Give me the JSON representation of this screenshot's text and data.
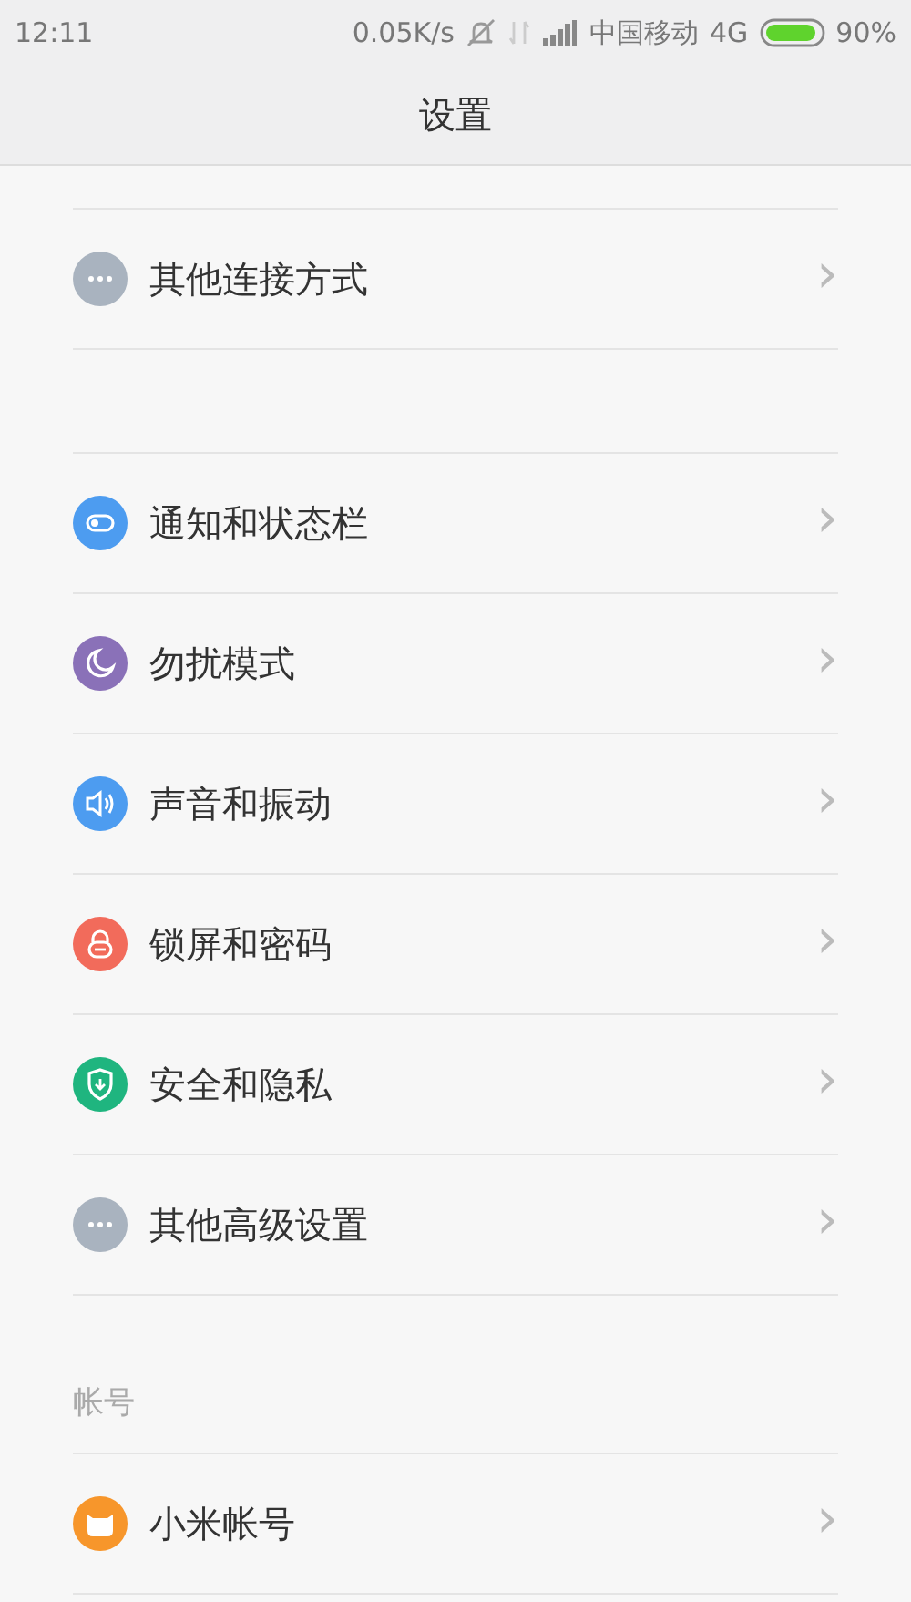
{
  "status_bar": {
    "time": "12:11",
    "speed": "0.05K/s",
    "carrier": "中国移动",
    "network": "4G",
    "battery": "90%"
  },
  "title": "设置",
  "groups": [
    {
      "items": [
        {
          "label": "其他连接方式",
          "kind": "dots",
          "color": "#a9b3bf",
          "chevron": "›"
        }
      ]
    },
    {
      "items": [
        {
          "label": "通知和状态栏",
          "kind": "toggle",
          "color": "#4d9cf0",
          "chevron": "›"
        },
        {
          "label": "勿扰模式",
          "kind": "moon",
          "color": "#8a71b8",
          "chevron": "›"
        },
        {
          "label": "声音和振动",
          "kind": "speaker",
          "color": "#4d9cf0",
          "chevron": "›"
        },
        {
          "label": "锁屏和密码",
          "kind": "lock",
          "color": "#f26b5b",
          "chevron": "›"
        },
        {
          "label": "安全和隐私",
          "kind": "shield",
          "color": "#1fb57f",
          "chevron": "›"
        },
        {
          "label": "其他高级设置",
          "kind": "dots",
          "color": "#a9b3bf",
          "chevron": "›"
        }
      ]
    },
    {
      "header": "帐号",
      "items": [
        {
          "label": "小米帐号",
          "kind": "mi",
          "color": "#f7962b",
          "chevron": "›"
        }
      ]
    }
  ]
}
